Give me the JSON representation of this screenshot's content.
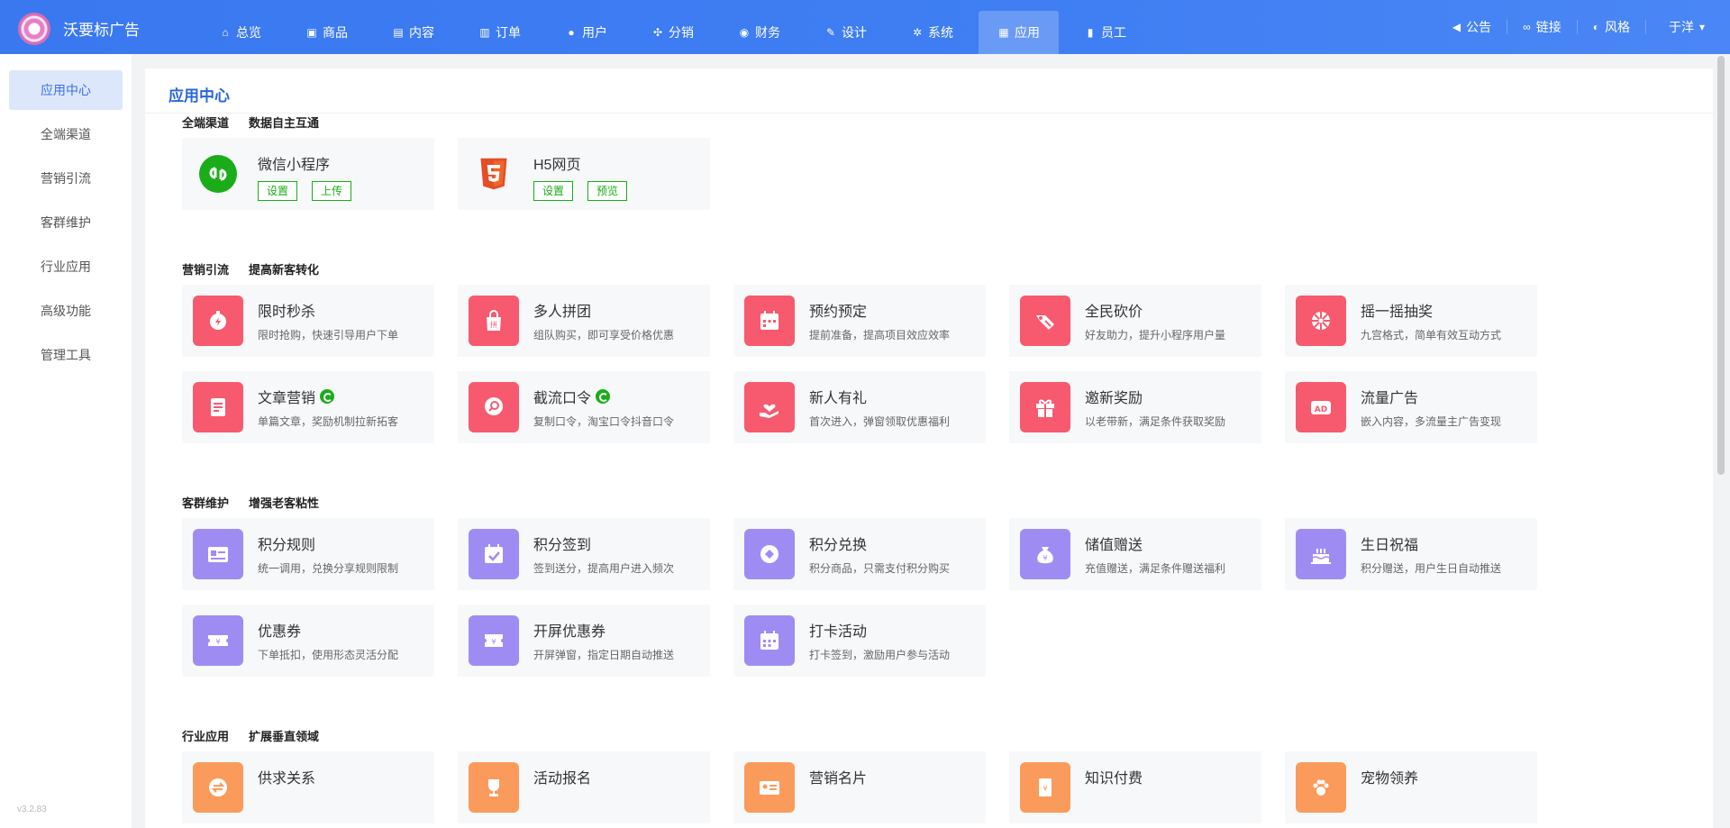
{
  "header": {
    "brand": "沃要标广告",
    "nav": [
      {
        "label": "总览",
        "icon": "home-icon",
        "glyph": "⌂"
      },
      {
        "label": "商品",
        "icon": "bag-icon",
        "glyph": "▣"
      },
      {
        "label": "内容",
        "icon": "document-icon",
        "glyph": "▤"
      },
      {
        "label": "订单",
        "icon": "clipboard-icon",
        "glyph": "▥"
      },
      {
        "label": "用户",
        "icon": "user-icon",
        "glyph": "●"
      },
      {
        "label": "分销",
        "icon": "share-icon",
        "glyph": "✣"
      },
      {
        "label": "财务",
        "icon": "money-bag-icon",
        "glyph": "◉"
      },
      {
        "label": "设计",
        "icon": "brush-icon",
        "glyph": "✎"
      },
      {
        "label": "系统",
        "icon": "gear-icon",
        "glyph": "✲"
      },
      {
        "label": "应用",
        "icon": "grid-icon",
        "glyph": "▦",
        "active": true
      },
      {
        "label": "员工",
        "icon": "lock-icon",
        "glyph": "▮"
      }
    ],
    "right": [
      {
        "label": "公告",
        "icon": "megaphone-icon",
        "glyph": "◀"
      },
      {
        "label": "链接",
        "icon": "link-icon",
        "glyph": "∞"
      },
      {
        "label": "风格",
        "icon": "palette-icon",
        "glyph": "◐"
      },
      {
        "label": "于洋",
        "icon": "chevron-down-icon",
        "glyph": "▾"
      }
    ]
  },
  "sidebar": {
    "items": [
      {
        "label": "应用中心",
        "active": true
      },
      {
        "label": "全端渠道"
      },
      {
        "label": "营销引流"
      },
      {
        "label": "客群维护"
      },
      {
        "label": "行业应用"
      },
      {
        "label": "高级功能"
      },
      {
        "label": "管理工具"
      }
    ],
    "version": "v3.2.83"
  },
  "main": {
    "title": "应用中心",
    "sections": [
      {
        "title": "全端渠道",
        "subtitle": "数据自主互通",
        "cards": [
          {
            "title": "微信小程序",
            "icon": "mini-program-icon",
            "buttons": [
              "设置",
              "上传"
            ]
          },
          {
            "title": "H5网页",
            "icon": "html5-icon",
            "buttons": [
              "设置",
              "预览"
            ]
          }
        ]
      },
      {
        "title": "营销引流",
        "subtitle": "提高新客转化",
        "cards": [
          {
            "title": "限时秒杀",
            "desc": "限时抢购，快速引导用户下单",
            "icon": "stopwatch-icon"
          },
          {
            "title": "多人拼团",
            "desc": "组队购买，即可享受价格优惠",
            "icon": "group-buy-icon"
          },
          {
            "title": "预约预定",
            "desc": "提前准备，提高项目效应效率",
            "icon": "calendar-icon"
          },
          {
            "title": "全民砍价",
            "desc": "好友助力，提升小程序用户量",
            "icon": "price-cut-icon"
          },
          {
            "title": "摇一摇抽奖",
            "desc": "九宫格式，简单有效互动方式",
            "icon": "wheel-icon"
          },
          {
            "title": "文章营销",
            "desc": "单篇文章，奖励机制拉新拓客",
            "icon": "article-icon",
            "badge": true
          },
          {
            "title": "截流口令",
            "desc": "复制口令，淘宝口令抖音口令",
            "icon": "search-bubble-icon",
            "badge": true
          },
          {
            "title": "新人有礼",
            "desc": "首次进入，弹窗领取优惠福利",
            "icon": "hand-heart-icon"
          },
          {
            "title": "邀新奖励",
            "desc": "以老带新，满足条件获取奖励",
            "icon": "gift-icon"
          },
          {
            "title": "流量广告",
            "desc": "嵌入内容，多流量主广告变现",
            "icon": "ad-icon"
          }
        ]
      },
      {
        "title": "客群维护",
        "subtitle": "增强老客粘性",
        "cards": [
          {
            "title": "积分规则",
            "desc": "统一调用，兑换分享规则限制",
            "icon": "rules-card-icon"
          },
          {
            "title": "积分签到",
            "desc": "签到送分，提高用户进入频次",
            "icon": "calendar-check-icon"
          },
          {
            "title": "积分兑换",
            "desc": "积分商品，只需支付积分购买",
            "icon": "diamond-icon"
          },
          {
            "title": "储值赠送",
            "desc": "充值赠送，满足条件赠送福利",
            "icon": "money-bag-icon"
          },
          {
            "title": "生日祝福",
            "desc": "积分赠送，用户生日自动推送",
            "icon": "cake-icon"
          },
          {
            "title": "优惠券",
            "desc": "下单抵扣，使用形态灵活分配",
            "icon": "coupon-icon"
          },
          {
            "title": "开屏优惠券",
            "desc": "开屏弹窗，指定日期自动推送",
            "icon": "ticket-icon"
          },
          {
            "title": "打卡活动",
            "desc": "打卡签到，激励用户参与活动",
            "icon": "calendar-grid-icon"
          }
        ]
      },
      {
        "title": "行业应用",
        "subtitle": "扩展垂直领域",
        "cards": [
          {
            "title": "供求关系",
            "icon": "exchange-icon"
          },
          {
            "title": "活动报名",
            "icon": "trophy-icon"
          },
          {
            "title": "营销名片",
            "icon": "id-card-icon"
          },
          {
            "title": "知识付费",
            "icon": "book-icon"
          },
          {
            "title": "宠物领养",
            "icon": "paw-icon"
          }
        ]
      }
    ]
  },
  "colors": {
    "header": "#3a78f0",
    "accent": "#2a66db",
    "marketing": "#f7596f",
    "loyalty": "#9f8cf3",
    "industry": "#fb9b5b",
    "wechat": "#1aad19",
    "html5": "#e44d26"
  }
}
